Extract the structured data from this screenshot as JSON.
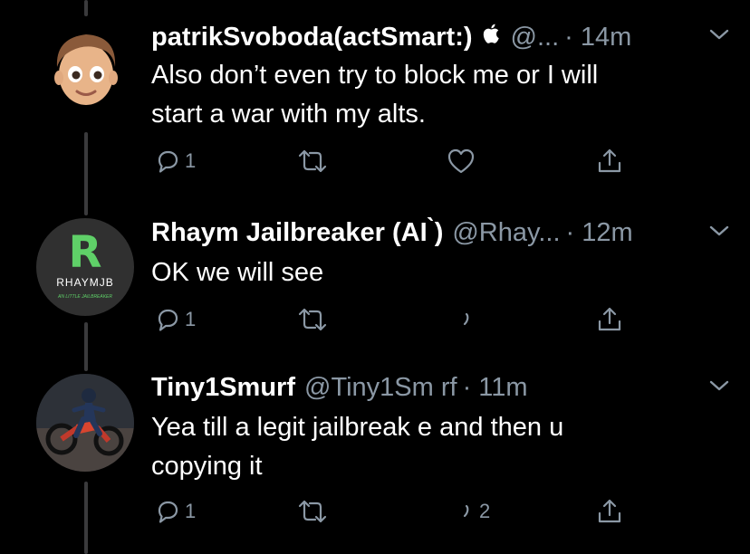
{
  "tweets": [
    {
      "name": "patrikSvoboda(actSmart:)",
      "handle": "@...",
      "time": "· 14m",
      "text_lines": [
        "Also don’t even try to block me or I will",
        "start a war with my alts."
      ],
      "reply_count": "1",
      "retweet_count": "",
      "like_count": "",
      "avatar_icon": "memoji-avatar",
      "badge_icon": "apple-icon"
    },
    {
      "name": "Rhaym Jailbreaker (AI  ̀)",
      "handle": "@Rhay...",
      "time": "· 12m",
      "text_lines": [
        "OK we will see"
      ],
      "reply_count": "1",
      "retweet_count": "",
      "like_count": "",
      "avatar_logo_letter": "R",
      "avatar_logo_name": "RHAYMJB",
      "avatar_logo_tagline": "AN LITTLE JAILBREAKER"
    },
    {
      "name": "Tiny1Smurf",
      "handle": "@Tiny1Sm  rf",
      "time": "· 11m",
      "text_lines": [
        "Yea till a legit jailbreak  e and then u",
        "copying it"
      ],
      "reply_count": "1",
      "retweet_count": "",
      "like_count": "2",
      "avatar_icon": "motocross-photo-avatar"
    }
  ],
  "colors": {
    "background": "#000000",
    "text": "#ffffff",
    "muted": "#8b98a5",
    "thread_line": "#3a3a3c",
    "logo_green": "#5fd068"
  }
}
